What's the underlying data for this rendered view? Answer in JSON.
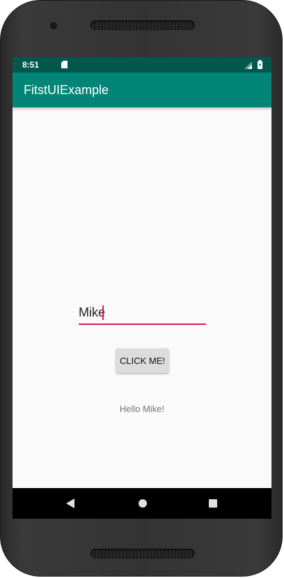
{
  "status_bar": {
    "time": "8:51",
    "icons": [
      "sd-card-icon",
      "signal-icon",
      "battery-icon"
    ]
  },
  "app_bar": {
    "title": "FitstUIExample"
  },
  "main": {
    "name_input_value": "Mike",
    "button_label": "CLICK ME!",
    "greeting_text": "Hello Mike!"
  },
  "nav_bar": {
    "icons": [
      "back-icon",
      "home-icon",
      "recents-icon"
    ]
  },
  "colors": {
    "status_bar": "#00574b",
    "app_bar": "#008577",
    "accent": "#d81b60",
    "background": "#fafafa"
  }
}
